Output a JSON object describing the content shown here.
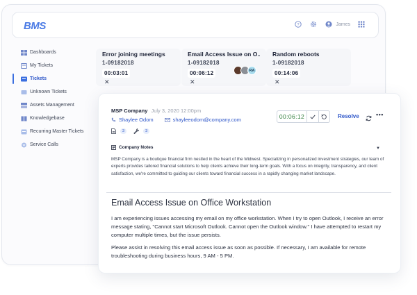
{
  "app": {
    "logo": "BMS",
    "user_name": "James"
  },
  "header_icons": [
    "help-icon",
    "settings-icon",
    "user-icon",
    "apps-grid-icon"
  ],
  "sidebar": {
    "items": [
      {
        "label": "Dashboards",
        "icon": "dashboard-icon",
        "active": false
      },
      {
        "label": "My Tickets",
        "icon": "my-tickets-icon",
        "active": false
      },
      {
        "label": "Tickets",
        "icon": "tickets-icon",
        "active": true
      },
      {
        "label": "Unknown Tickets",
        "icon": "unknown-tickets-icon",
        "active": false
      },
      {
        "label": "Assets Management",
        "icon": "assets-icon",
        "active": false
      },
      {
        "label": "Knowledgebase",
        "icon": "knowledgebase-icon",
        "active": false
      },
      {
        "label": "Recurring Master Tickets",
        "icon": "recurring-icon",
        "active": false
      },
      {
        "label": "Service Calls",
        "icon": "service-calls-icon",
        "active": false
      }
    ]
  },
  "ticket_cards": [
    {
      "title": "Error joining meetings",
      "number": "1-09182018",
      "timer": "00:03:01"
    },
    {
      "title": "Email Access Issue on O...",
      "number": "1-09182018",
      "timer": "00:06:12",
      "avatar_initials": "RA"
    },
    {
      "title": "Random reboots",
      "number": "1-09182018",
      "timer": "00:14:06"
    }
  ],
  "detail": {
    "company": "MSP Company",
    "datetime": "July 3, 2020 12:00pm",
    "contact_name": "Shaylee Odom",
    "contact_email": "shayleeodom@company.com",
    "attachments_count": "3",
    "tools_count": "3",
    "timer": "00:06:12",
    "resolve_label": "Resolve",
    "more_label": "•••",
    "notes_label": "Company Notes",
    "notes_text": "MSP Company is a boutique financial firm nestled in the heart of the Midwest. Specializing in personalized investment strategies, our team of experts provides tailored financial solutions to help clients achieve their long-term goals. With a focus on integrity, transparency, and client satisfaction, we're committed to guiding our clients toward financial success in a rapidly changing market landscape.",
    "issue_title": "Email Access Issue on Office Workstation",
    "issue_paragraph_1": "I am experiencing issues accessing my email on my office workstation. When I try to open Outlook, I receive an error message stating, \"Cannot start Microsoft Outlook. Cannot open the Outlook window.\" I have attempted to restart my computer multiple times, but the issue persists.",
    "issue_paragraph_2": "Please assist in resolving this email access issue as soon as possible. If necessary, I am available for remote troubleshooting during business hours, 9 AM - 5 PM."
  },
  "colors": {
    "accent": "#2f57c9",
    "timer_green": "#2f7d3a",
    "text_dark": "#20263a"
  }
}
